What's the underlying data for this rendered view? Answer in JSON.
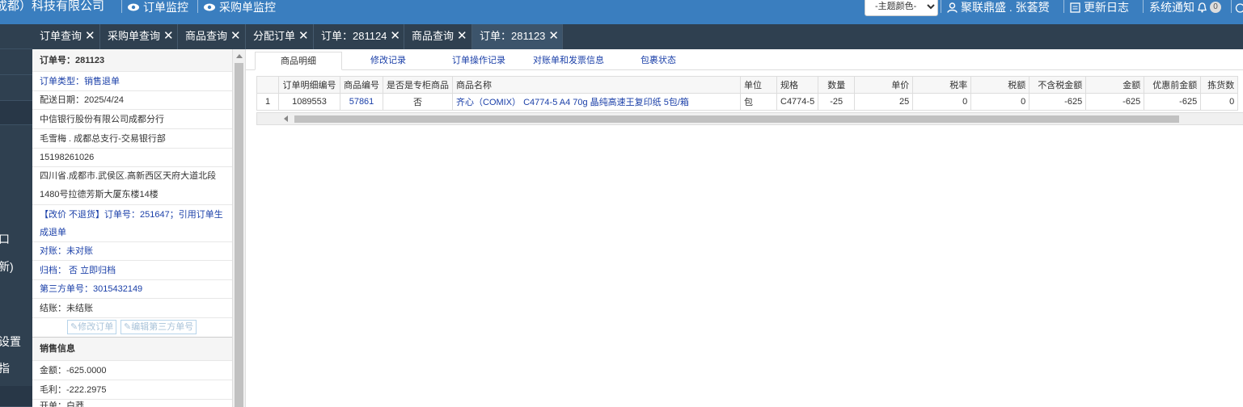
{
  "header": {
    "company": "成都）科技有限公司",
    "links": [
      {
        "label": "订单监控",
        "icon": "eye-icon"
      },
      {
        "label": "采购单监控",
        "icon": "eye-icon"
      }
    ],
    "theme_select": "-主题颜色-",
    "user": "聚联鼎盛 . 张荟赟",
    "update_log": "更新日志",
    "notifications": "系统通知",
    "notification_count": "0",
    "colors": {
      "topbar": "#3a7ebf",
      "sidebar": "#2f4050",
      "link": "#1a3fa8"
    }
  },
  "sidebar": {
    "fragments": [
      "口",
      "新)",
      "设置",
      "指"
    ]
  },
  "tabs": [
    {
      "label": "订单查询",
      "close": "✕"
    },
    {
      "label": "采购单查询",
      "close": "✕"
    },
    {
      "label": "商品查询",
      "close": "✕"
    },
    {
      "label": "分配订单",
      "close": "✕"
    },
    {
      "label": "订单：281124",
      "close": "✕"
    },
    {
      "label": "商品查询",
      "close": "✕"
    },
    {
      "label": "订单：281123",
      "close": "✕",
      "active": true
    }
  ],
  "order": {
    "title": "订单号：281123",
    "type": "订单类型：销售退单",
    "delivery_date": "配送日期：2025/4/24",
    "customer": "中信银行股份有限公司成都分行",
    "contact": "毛雪梅 . 成都总支行-交易银行部",
    "phone": "15198261026",
    "address_line1": "四川省.成都市.武侯区.高新西区天府大道北段",
    "address_line2": "1480号拉德芳斯大厦东楼14楼",
    "note_line1": "【改价 不退货】订单号：251647；引用订单生",
    "note_line2": "成退单",
    "reconcile": "对账：未对账",
    "archive": "归档： 否 立即归档",
    "third_party": "第三方单号：3015432149",
    "settlement": "结账：未结账",
    "btn_edit_order": "修改订单",
    "btn_edit_third": "编辑第三方单号"
  },
  "sales": {
    "title": "销售信息",
    "amount": "金额：-625.0000",
    "profit": "毛利：-222.2975",
    "partial": "开单：白莽"
  },
  "subtabs": [
    "商品明细",
    "修改记录",
    "订单操作记录",
    "对账单和发票信息",
    "包裹状态"
  ],
  "grid": {
    "columns": [
      "",
      "订单明细编号",
      "商品编号",
      "是否是专柜商品",
      "商品名称",
      "单位",
      "规格",
      "数量",
      "单价",
      "税率",
      "税额",
      "不含税金额",
      "金额",
      "优惠前金额",
      "拣货数"
    ],
    "rows": [
      [
        "1",
        "1089553",
        "57861",
        "否",
        "齐心（COMIX） C4774-5 A4 70g 晶纯高速王复印纸 5包/箱",
        "包",
        "C4774-5",
        "-25",
        "25",
        "0",
        "0",
        "-625",
        "-625",
        "-625",
        "0"
      ]
    ]
  }
}
